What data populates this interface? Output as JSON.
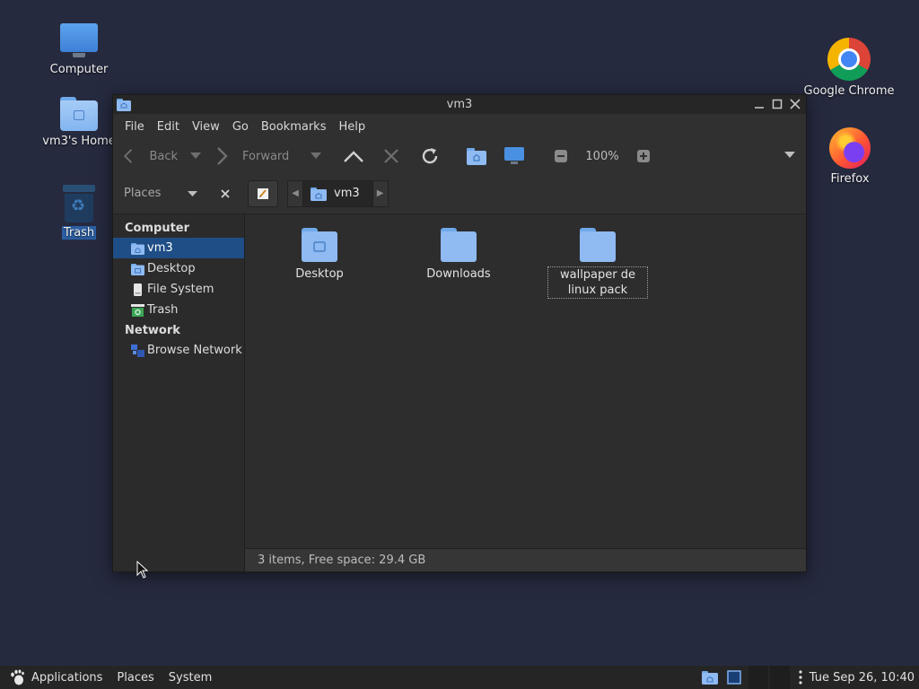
{
  "desktop": {
    "icons": [
      {
        "label": "Computer"
      },
      {
        "label": "vm3's Home"
      },
      {
        "label": "Trash"
      },
      {
        "label": "Google Chrome"
      },
      {
        "label": "Firefox"
      }
    ]
  },
  "window": {
    "title": "vm3",
    "menu": [
      "File",
      "Edit",
      "View",
      "Go",
      "Bookmarks",
      "Help"
    ],
    "toolbar": {
      "back_label": "Back",
      "forward_label": "Forward",
      "zoom": "100%"
    },
    "places_label": "Places",
    "breadcrumb": "vm3",
    "sidebar": {
      "computer_heading": "Computer",
      "computer_items": [
        "vm3",
        "Desktop",
        "File System",
        "Trash"
      ],
      "network_heading": "Network",
      "network_items": [
        "Browse Network"
      ]
    },
    "files": [
      {
        "name": "Desktop"
      },
      {
        "name": "Downloads"
      },
      {
        "name": "wallpaper de linux pack"
      }
    ],
    "status": "3 items, Free space: 29.4 GB"
  },
  "taskbar": {
    "applications": "Applications",
    "places": "Places",
    "system": "System",
    "clock": "Tue Sep 26, 10:40"
  },
  "colors": {
    "desktop_bg": "#262a3f",
    "selection": "#1f4e86",
    "folder": "#8fbaf2"
  }
}
